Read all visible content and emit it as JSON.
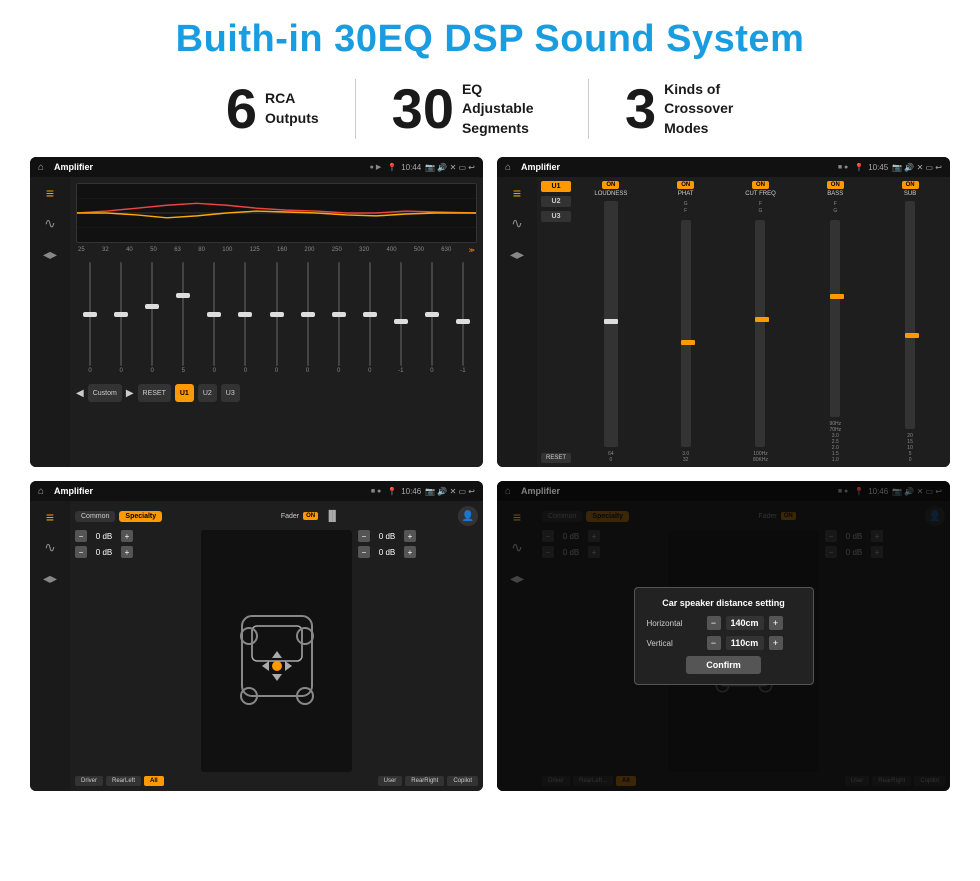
{
  "page": {
    "main_title": "Buith-in 30EQ DSP Sound System",
    "features": [
      {
        "number": "6",
        "text": "RCA\nOutputs"
      },
      {
        "number": "30",
        "text": "EQ Adjustable\nSegments"
      },
      {
        "number": "3",
        "text": "Kinds of\nCrossover Modes"
      }
    ],
    "screens": [
      {
        "id": "eq-screen",
        "status_bar": {
          "app": "Amplifier",
          "time": "10:44"
        },
        "freq_labels": [
          "25",
          "32",
          "40",
          "50",
          "63",
          "80",
          "100",
          "125",
          "160",
          "200",
          "250",
          "320",
          "400",
          "500",
          "630"
        ],
        "slider_values": [
          "0",
          "0",
          "0",
          "5",
          "0",
          "0",
          "0",
          "0",
          "0",
          "0",
          "-1",
          "0",
          "-1"
        ],
        "bottom_buttons": [
          "◀",
          "Custom",
          "▶",
          "RESET",
          "U1",
          "U2",
          "U3"
        ]
      },
      {
        "id": "amp2-screen",
        "status_bar": {
          "app": "Amplifier",
          "time": "10:45"
        },
        "presets": [
          "U1",
          "U2",
          "U3"
        ],
        "channels": [
          {
            "label": "LOUDNESS",
            "on": true
          },
          {
            "label": "PHAT",
            "on": true
          },
          {
            "label": "CUT FREQ",
            "on": true
          },
          {
            "label": "BASS",
            "on": true
          },
          {
            "label": "SUB",
            "on": true
          }
        ],
        "reset_label": "RESET"
      },
      {
        "id": "crossover-screen",
        "status_bar": {
          "app": "Amplifier",
          "time": "10:46"
        },
        "tabs": [
          "Common",
          "Specialty"
        ],
        "fader_label": "Fader",
        "on_label": "ON",
        "volumes": [
          {
            "label": "— 0 dB +"
          },
          {
            "label": "— 0 dB +"
          },
          {
            "label": "— 0 dB +"
          },
          {
            "label": "— 0 dB +"
          }
        ],
        "bottom_buttons": [
          "Driver",
          "RearLeft",
          "All",
          "User",
          "RearRight",
          "Copilot"
        ]
      },
      {
        "id": "dialog-screen",
        "status_bar": {
          "app": "Amplifier",
          "time": "10:46"
        },
        "dialog": {
          "title": "Car speaker distance setting",
          "horizontal_label": "Horizontal",
          "horizontal_value": "140cm",
          "vertical_label": "Vertical",
          "vertical_value": "110cm",
          "confirm_label": "Confirm"
        },
        "tabs": [
          "Common",
          "Specialty"
        ],
        "on_label": "ON",
        "bottom_buttons": [
          "Driver",
          "RearLeft",
          "All",
          "User",
          "RearRight",
          "Copilot"
        ]
      }
    ]
  }
}
